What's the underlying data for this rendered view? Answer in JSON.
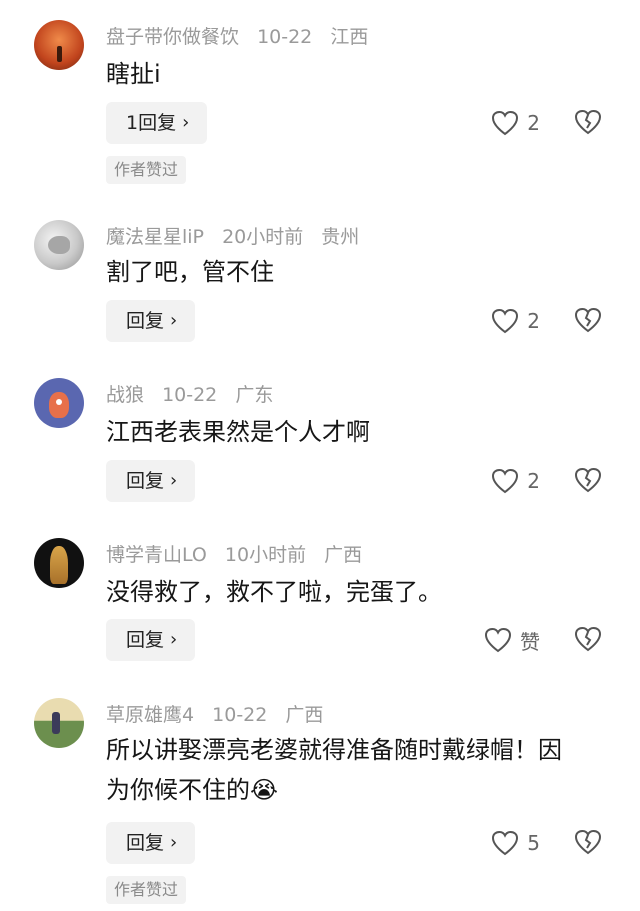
{
  "comments": [
    {
      "username": "盘子带你做餐饮",
      "date": "10-22",
      "location": "江西",
      "text": "瞎扯i",
      "reply_label": "1回复",
      "like_count": "2",
      "author_liked": "作者赞过",
      "avatar_colors": [
        "#e0592a",
        "#7a2e14"
      ]
    },
    {
      "username": "魔法星星liP",
      "date": "20小时前",
      "location": "贵州",
      "text": "割了吧，管不住",
      "reply_label": "回复",
      "like_count": "2",
      "avatar_colors": [
        "#d8d8d8",
        "#8a8a8a"
      ]
    },
    {
      "username": "战狼",
      "date": "10-22",
      "location": "广东",
      "text": "江西老表果然是个人才啊",
      "reply_label": "回复",
      "like_count": "2",
      "avatar_colors": [
        "#5a67b0",
        "#e7704a"
      ]
    },
    {
      "username": "博学青山LO",
      "date": "10小时前",
      "location": "广西",
      "text": "没得救了，救不了啦，完蛋了。",
      "reply_label": "回复",
      "like_count": "赞",
      "avatar_colors": [
        "#1a1a1a",
        "#c8953c"
      ]
    },
    {
      "username": "草原雄鹰4",
      "date": "10-22",
      "location": "广西",
      "text": "所以讲娶漂亮老婆就得准备随时戴绿帽！因为你候不住的",
      "emoji": "😭",
      "reply_label": "回复",
      "like_count": "5",
      "author_liked": "作者赞过",
      "avatar_colors": [
        "#d7c78f",
        "#4a6a3a"
      ]
    }
  ]
}
